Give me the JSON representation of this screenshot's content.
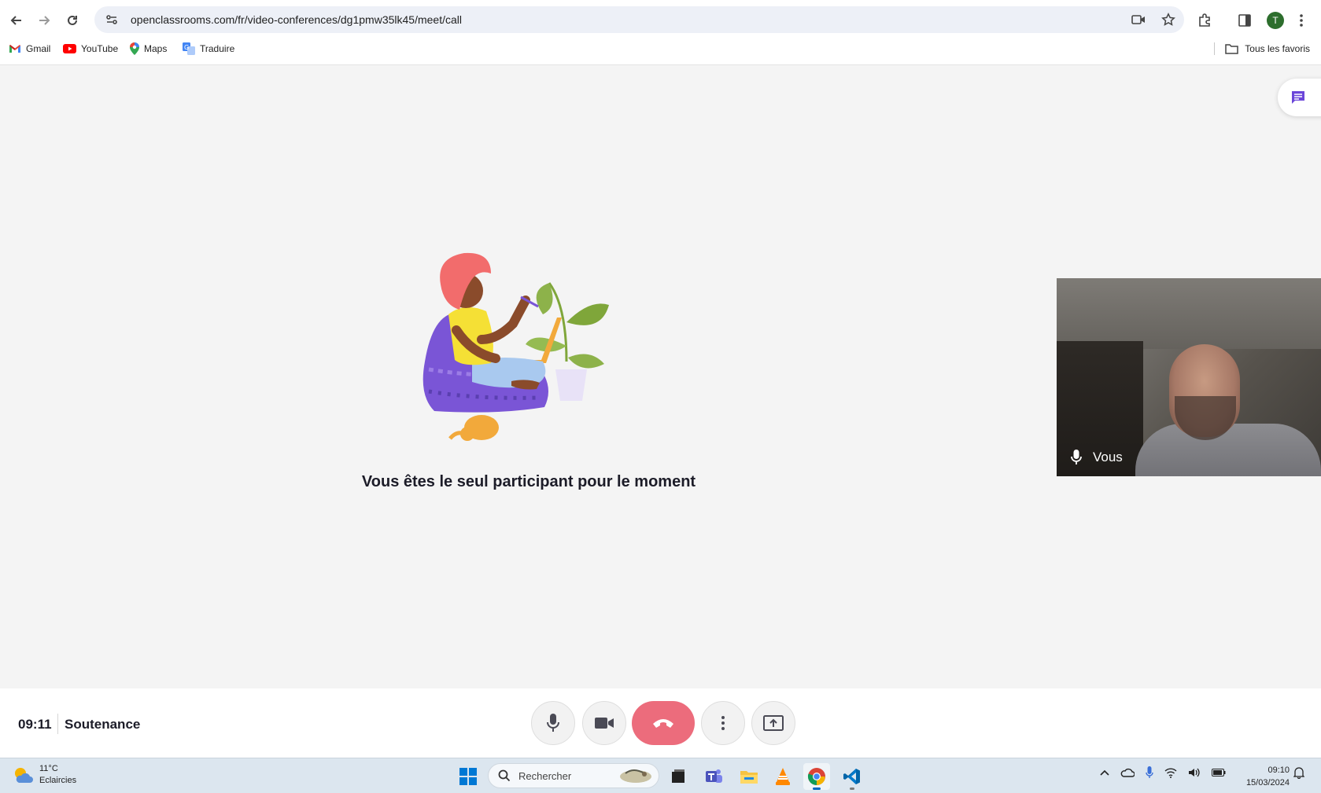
{
  "browser": {
    "url": "openclassrooms.com/fr/video-conferences/dg1pmw35lk45/meet/call",
    "profile_initial": "T",
    "bookmarks": [
      {
        "label": "Gmail",
        "icon": "gmail-icon"
      },
      {
        "label": "YouTube",
        "icon": "youtube-icon"
      },
      {
        "label": "Maps",
        "icon": "maps-icon"
      },
      {
        "label": "Traduire",
        "icon": "translate-icon"
      }
    ],
    "all_bookmarks_label": "Tous les favoris"
  },
  "meeting": {
    "empty_message": "Vous êtes le seul participant pour le moment",
    "self_label": "Vous",
    "time": "09:11",
    "title": "Soutenance",
    "accent_color": "#7a4fd6",
    "hangup_color": "#ec6c7c"
  },
  "taskbar": {
    "weather_temp": "11°C",
    "weather_desc": "Eclaircies",
    "search_placeholder": "Rechercher",
    "clock_time": "09:10",
    "clock_date": "15/03/2024"
  }
}
